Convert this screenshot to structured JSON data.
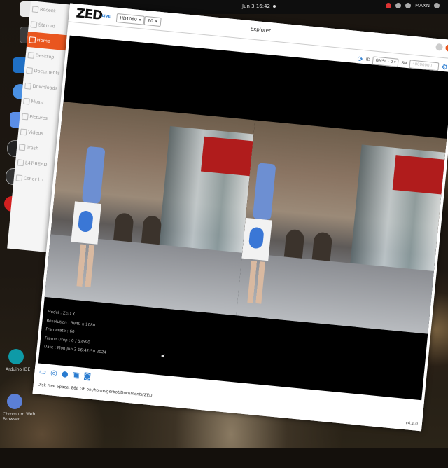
{
  "topbar": {
    "clock": "Jun 3 16:42",
    "user": "MAXN"
  },
  "dock": {
    "items": [
      "files-icon",
      "terminal-icon",
      "vscode-icon",
      "chromium-icon",
      "editor-icon",
      "obs-icon",
      "app-store-icon",
      "help-icon"
    ],
    "labels": {
      "arduino": "Arduino IDE",
      "chromium": "Chromium Web Browser"
    }
  },
  "files": {
    "items": [
      {
        "label": "Recent",
        "active": false
      },
      {
        "label": "Starred",
        "active": false
      },
      {
        "label": "Home",
        "active": true
      },
      {
        "label": "Desktop",
        "active": false
      },
      {
        "label": "Documents",
        "active": false
      },
      {
        "label": "Downloads",
        "active": false
      },
      {
        "label": "Music",
        "active": false
      },
      {
        "label": "Pictures",
        "active": false
      },
      {
        "label": "Videos",
        "active": false
      },
      {
        "label": "Trash",
        "active": false
      },
      {
        "label": "L4T-READ",
        "active": false
      },
      {
        "label": "Other Lo",
        "active": false
      }
    ]
  },
  "zed": {
    "logo": "ZED",
    "live": "LIVE",
    "resolution": "HD1080",
    "fps": "60",
    "title": "Explorer",
    "id_label": "ID",
    "camera": "GMSL - 0",
    "sn_label": "SN",
    "sn_placeholder": "40000000",
    "info": {
      "model": "Model : ZED X",
      "resolution": "Resolution : 3840 x 1080",
      "framerate": "Framerate : 60",
      "frame_drop": "Frame Drop : 0 / 53590",
      "date": "Date : Mon Jun 3 16:42:50 2024"
    },
    "disk": "Disk Free Space: 868 Gb  on  /home/gerbot/Documents/ZED",
    "version": "v4.1.0"
  },
  "colors": {
    "accent": "#e9561f",
    "blue": "#2a7cd0",
    "banner_red": "#b01c1c"
  }
}
